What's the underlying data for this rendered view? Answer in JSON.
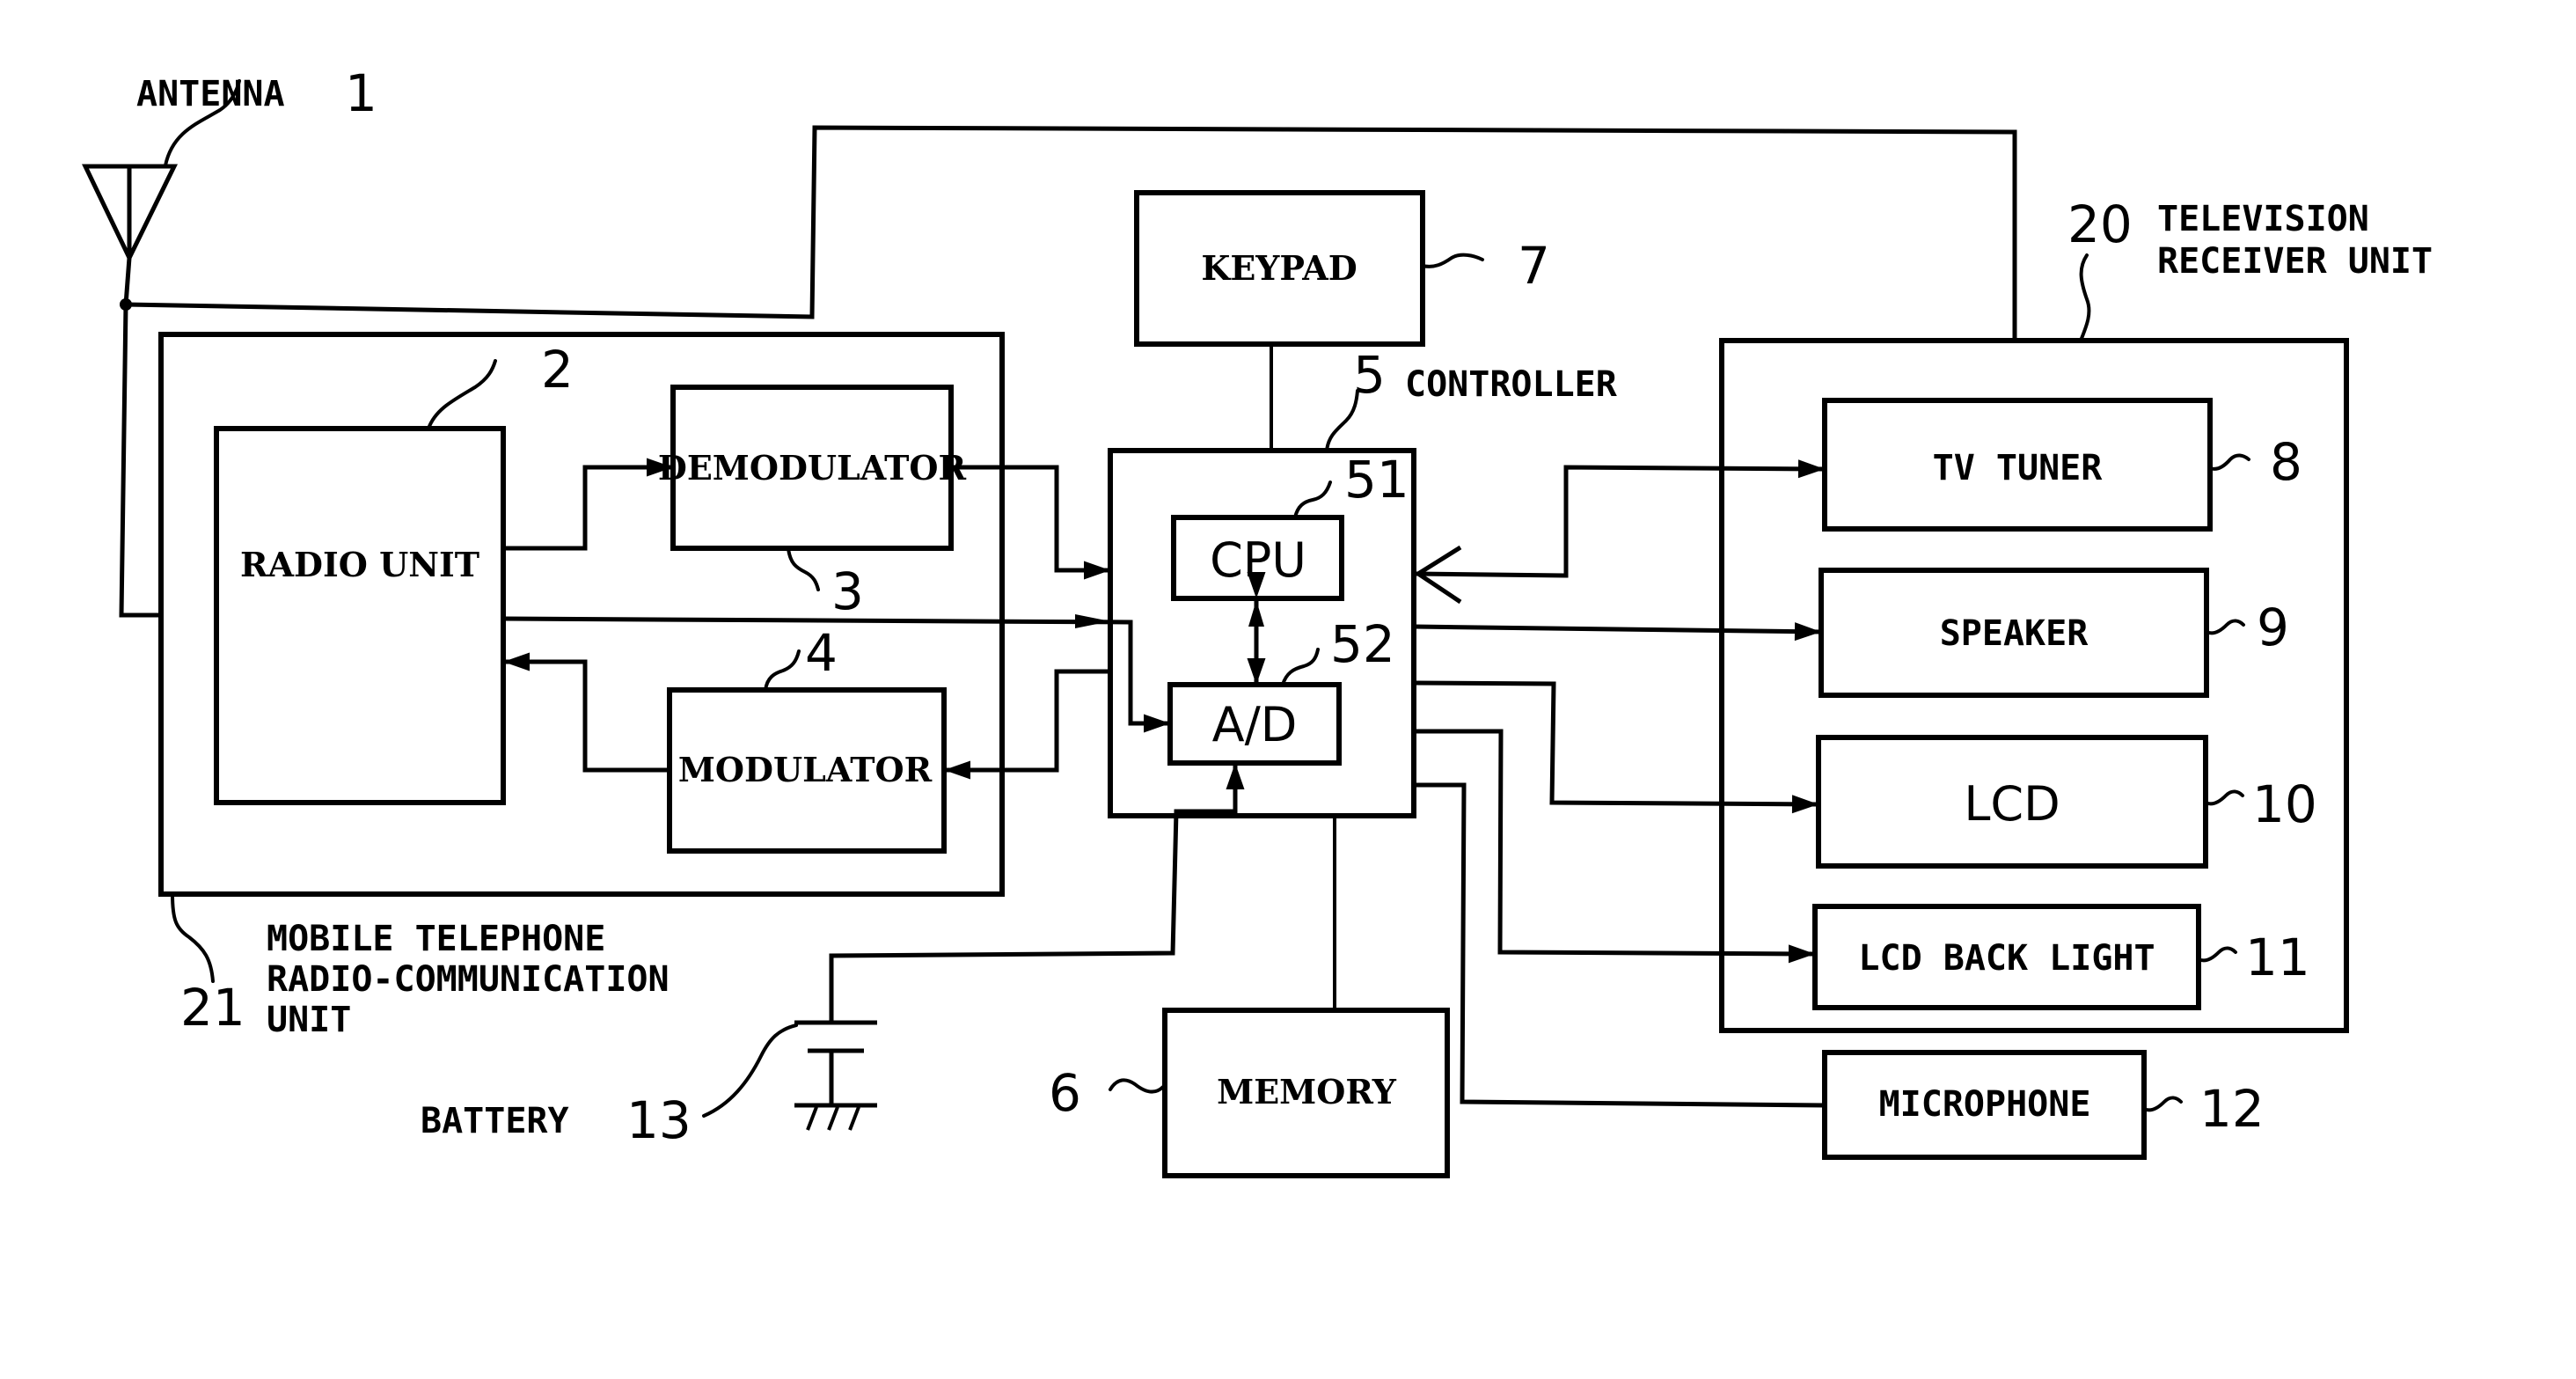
{
  "figure": {
    "type": "block-diagram",
    "subject": "Mobile telephone with television receiver"
  },
  "antenna": {
    "label": "ANTENNA",
    "ref": "1"
  },
  "mobile_unit": {
    "ref": "21",
    "label_lines": [
      "MOBILE TELEPHONE",
      "RADIO-COMMUNICATION",
      "UNIT"
    ]
  },
  "tv_unit": {
    "ref": "20",
    "label_lines": [
      "TELEVISION",
      "RECEIVER UNIT"
    ]
  },
  "controller": {
    "label": "CONTROLLER",
    "ref": "5"
  },
  "blocks": {
    "radio_unit": {
      "label": "RADIO UNIT",
      "ref": "2"
    },
    "demodulator": {
      "label": "DEMODULATOR",
      "ref": "3"
    },
    "modulator": {
      "label": "MODULATOR",
      "ref": "4"
    },
    "keypad": {
      "label": "KEYPAD",
      "ref": "7"
    },
    "cpu": {
      "label": "CPU",
      "ref": "51"
    },
    "ad": {
      "label": "A/D",
      "ref": "52"
    },
    "memory": {
      "label": "MEMORY",
      "ref": "6"
    },
    "tv_tuner": {
      "label": "TV TUNER",
      "ref": "8"
    },
    "speaker": {
      "label": "SPEAKER",
      "ref": "9"
    },
    "lcd": {
      "label": "LCD",
      "ref": "10"
    },
    "lcd_back_light": {
      "label": "LCD BACK LIGHT",
      "ref": "11"
    },
    "microphone": {
      "label": "MICROPHONE",
      "ref": "12"
    }
  },
  "battery": {
    "label": "BATTERY",
    "ref": "13"
  },
  "connections": [
    {
      "from": "ANTENNA",
      "to": "RADIO UNIT",
      "arrow": "none"
    },
    {
      "from": "ANTENNA",
      "to": "TV TUNER",
      "arrow": "forward"
    },
    {
      "from": "RADIO UNIT",
      "to": "DEMODULATOR",
      "arrow": "forward"
    },
    {
      "from": "DEMODULATOR",
      "to": "CONTROLLER",
      "arrow": "forward"
    },
    {
      "from": "RADIO UNIT",
      "to": "A/D",
      "arrow": "forward"
    },
    {
      "from": "MODULATOR",
      "to": "RADIO UNIT",
      "arrow": "forward"
    },
    {
      "from": "CONTROLLER",
      "to": "MODULATOR",
      "arrow": "forward"
    },
    {
      "from": "CPU",
      "to": "A/D",
      "arrow": "both"
    },
    {
      "from": "KEYPAD",
      "to": "CONTROLLER",
      "arrow": "none"
    },
    {
      "from": "CONTROLLER",
      "to": "TV TUNER",
      "arrow": "both"
    },
    {
      "from": "CONTROLLER",
      "to": "SPEAKER",
      "arrow": "forward"
    },
    {
      "from": "CONTROLLER",
      "to": "LCD",
      "arrow": "forward"
    },
    {
      "from": "CONTROLLER",
      "to": "LCD BACK LIGHT",
      "arrow": "forward"
    },
    {
      "from": "CONTROLLER",
      "to": "MICROPHONE",
      "arrow": "none"
    },
    {
      "from": "CONTROLLER",
      "to": "MEMORY",
      "arrow": "none"
    },
    {
      "from": "BATTERY",
      "to": "A/D",
      "arrow": "forward"
    }
  ]
}
